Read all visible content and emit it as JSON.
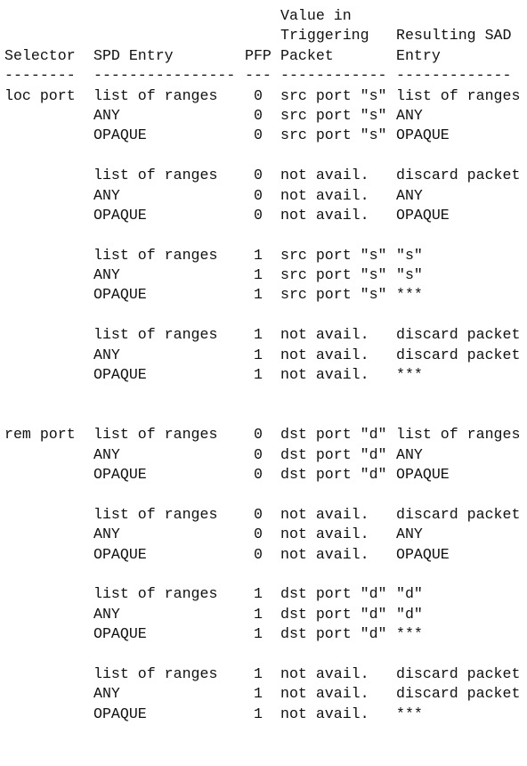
{
  "header": {
    "lines": [
      [
        "",
        "",
        "",
        "Value in",
        ""
      ],
      [
        "",
        "",
        "",
        "Triggering",
        "Resulting SAD"
      ],
      [
        "Selector",
        "SPD Entry",
        "PFP",
        "Packet",
        "Entry"
      ],
      [
        "--------",
        "----------------",
        "---",
        "------------",
        "-------------"
      ]
    ]
  },
  "sections": [
    {
      "selector": "loc port",
      "groups": [
        [
          [
            "list of ranges",
            "0",
            "src port ″s″",
            "list of ranges"
          ],
          [
            "ANY",
            "0",
            "src port ″s″",
            "ANY"
          ],
          [
            "OPAQUE",
            "0",
            "src port ″s″",
            "OPAQUE"
          ]
        ],
        [
          [
            "list of ranges",
            "0",
            "not avail.",
            "discard packet"
          ],
          [
            "ANY",
            "0",
            "not avail.",
            "ANY"
          ],
          [
            "OPAQUE",
            "0",
            "not avail.",
            "OPAQUE"
          ]
        ],
        [
          [
            "list of ranges",
            "1",
            "src port ″s″",
            "″s″"
          ],
          [
            "ANY",
            "1",
            "src port ″s″",
            "″s″"
          ],
          [
            "OPAQUE",
            "1",
            "src port ″s″",
            "***"
          ]
        ],
        [
          [
            "list of ranges",
            "1",
            "not avail.",
            "discard packet"
          ],
          [
            "ANY",
            "1",
            "not avail.",
            "discard packet"
          ],
          [
            "OPAQUE",
            "1",
            "not avail.",
            "***"
          ]
        ]
      ]
    },
    {
      "selector": "rem port",
      "groups": [
        [
          [
            "list of ranges",
            "0",
            "dst port ″d″",
            "list of ranges"
          ],
          [
            "ANY",
            "0",
            "dst port ″d″",
            "ANY"
          ],
          [
            "OPAQUE",
            "0",
            "dst port ″d″",
            "OPAQUE"
          ]
        ],
        [
          [
            "list of ranges",
            "0",
            "not avail.",
            "discard packet"
          ],
          [
            "ANY",
            "0",
            "not avail.",
            "ANY"
          ],
          [
            "OPAQUE",
            "0",
            "not avail.",
            "OPAQUE"
          ]
        ],
        [
          [
            "list of ranges",
            "1",
            "dst port ″d″",
            "″d″"
          ],
          [
            "ANY",
            "1",
            "dst port ″d″",
            "″d″"
          ],
          [
            "OPAQUE",
            "1",
            "dst port ″d″",
            "***"
          ]
        ],
        [
          [
            "list of ranges",
            "1",
            "not avail.",
            "discard packet"
          ],
          [
            "ANY",
            "1",
            "not avail.",
            "discard packet"
          ],
          [
            "OPAQUE",
            "1",
            "not avail.",
            "***"
          ]
        ]
      ]
    }
  ]
}
